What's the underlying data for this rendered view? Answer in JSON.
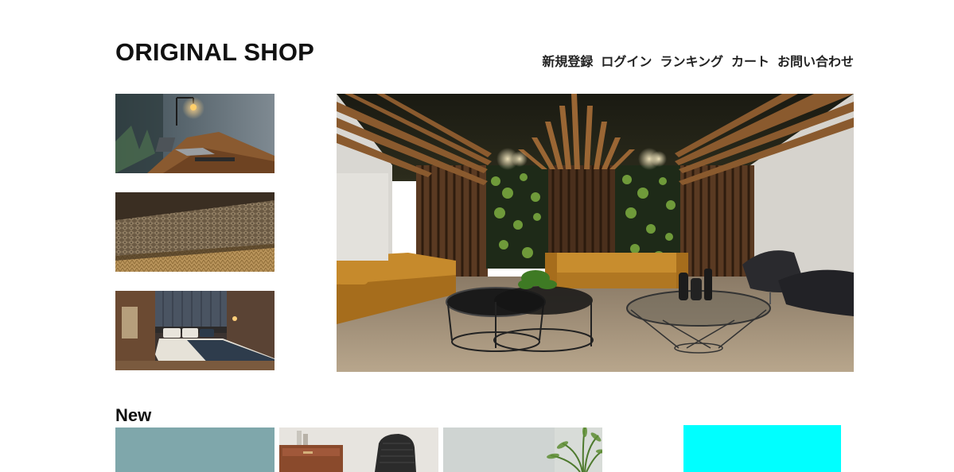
{
  "header": {
    "logo": "ORIGINAL SHOP",
    "nav": [
      "新規登録",
      "ログイン",
      "ランキング",
      "カート",
      "お問い合わせ"
    ]
  },
  "thumbnails": [
    {
      "name": "desk-lamp-photo"
    },
    {
      "name": "rug-texture-photo"
    },
    {
      "name": "bedroom-photo"
    }
  ],
  "hero": {
    "name": "lounge-interior-photo"
  },
  "new_section": {
    "title": "New",
    "items": [
      {
        "name": "teal-placeholder",
        "color": "#7fa7ab"
      },
      {
        "name": "chair-cabinet-photo"
      },
      {
        "name": "plant-wall-photo"
      },
      {
        "name": "cyan-placeholder",
        "color": "#00ffff"
      }
    ]
  },
  "colors": {
    "background": "#ffffff",
    "text": "#111111",
    "cyan_block": "#00ffff",
    "teal_block": "#7fa7ab"
  }
}
